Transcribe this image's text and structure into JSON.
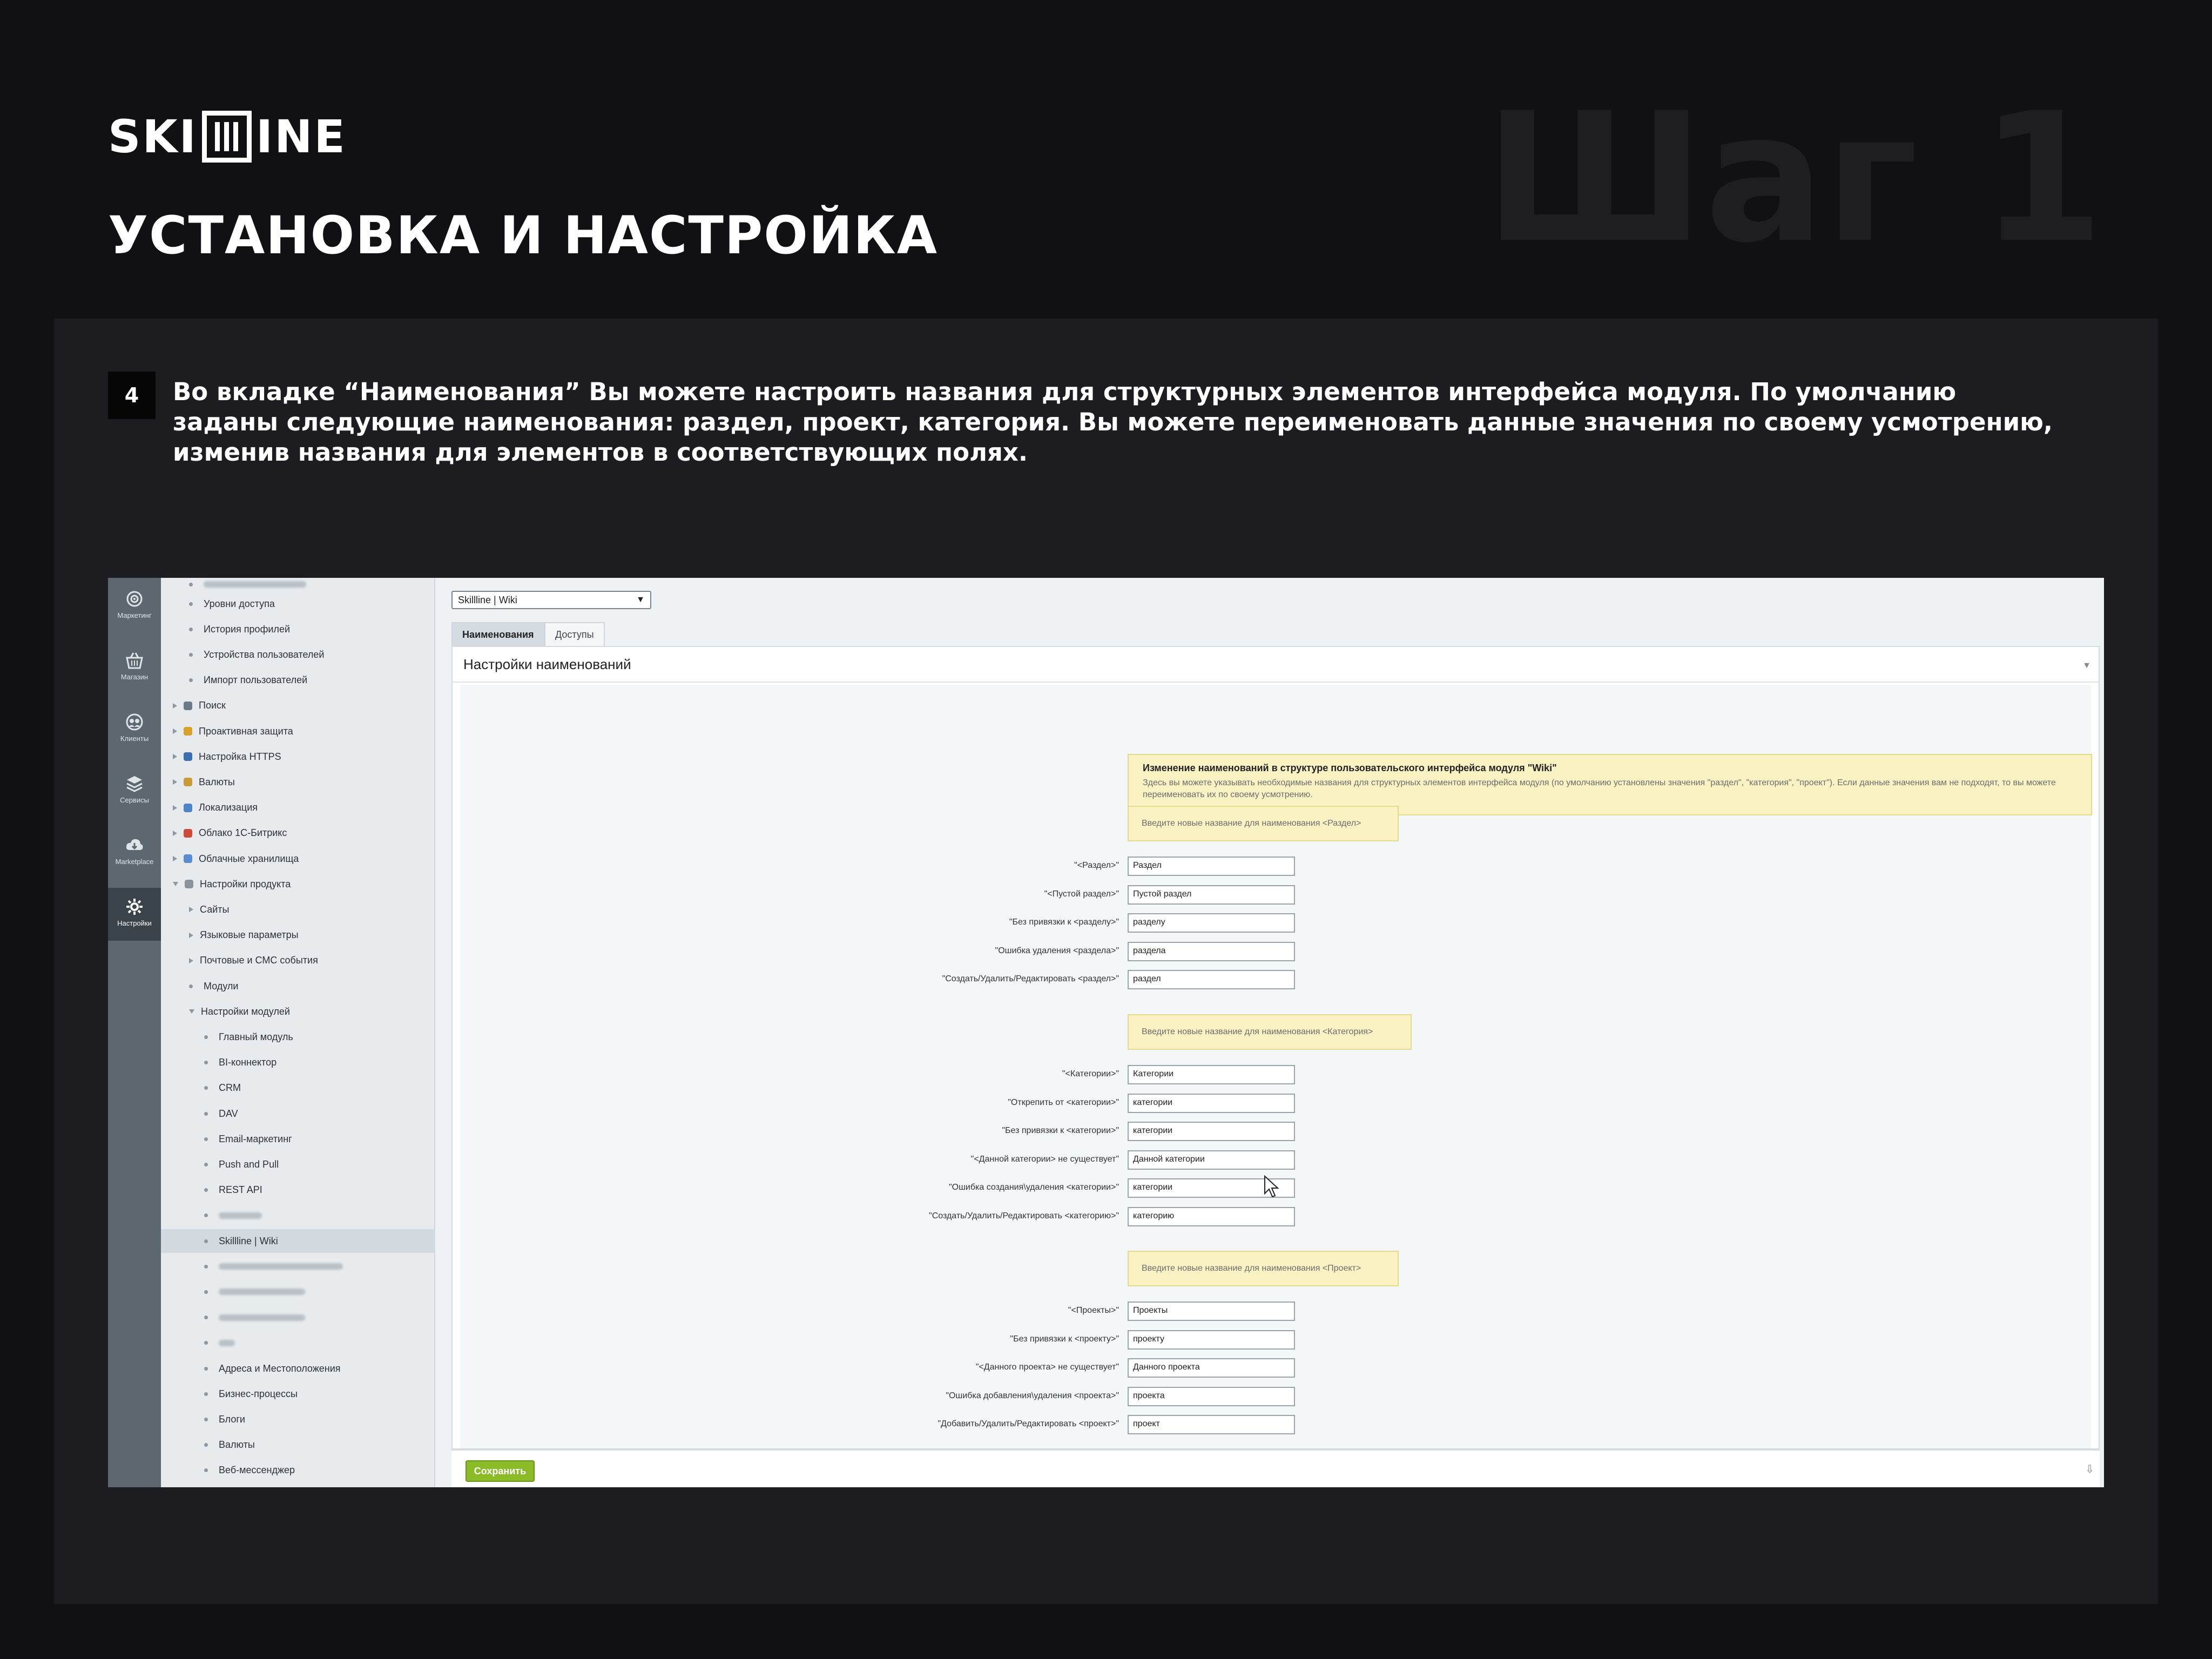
{
  "slide": {
    "logo_left": "SKI",
    "logo_right": "INE",
    "title": "УСТАНОВКА И НАСТРОЙКА",
    "step": "Шаг 1",
    "item_number": "4",
    "instruction": "Во вкладке “Наименования” Вы можете настроить названия для структурных элементов интерфейса модуля. По умолчанию заданы следующие наименования: раздел, проект, категория. Вы можете переименовать данные значения по своему усмотрению, изменив названия для элементов в соответствующих полях."
  },
  "rail": [
    {
      "label": "Маркетинг",
      "icon": "target-icon"
    },
    {
      "label": "Магазин",
      "icon": "basket-icon"
    },
    {
      "label": "Клиенты",
      "icon": "clients-icon"
    },
    {
      "label": "Сервисы",
      "icon": "layers-icon"
    },
    {
      "label": "Marketplace",
      "icon": "cloud-download-icon"
    },
    {
      "label": "Настройки",
      "icon": "gear-icon",
      "active": true
    }
  ],
  "tree": [
    {
      "label": "Уровни доступа",
      "level": 2,
      "kind": "bullet"
    },
    {
      "label": "История профилей",
      "level": 2,
      "kind": "bullet"
    },
    {
      "label": "Устройства пользователей",
      "level": 2,
      "kind": "bullet"
    },
    {
      "label": "Импорт пользователей",
      "level": 2,
      "kind": "bullet"
    },
    {
      "label": "Поиск",
      "level": 1,
      "kind": "arrow",
      "icon": "#6b7a86"
    },
    {
      "label": "Проактивная защита",
      "level": 1,
      "kind": "arrow",
      "icon": "#d7a12b"
    },
    {
      "label": "Настройка HTTPS",
      "level": 1,
      "kind": "arrow",
      "icon": "#3b6fb0"
    },
    {
      "label": "Валюты",
      "level": 1,
      "kind": "arrow",
      "icon": "#c89a3a"
    },
    {
      "label": "Локализация",
      "level": 1,
      "kind": "arrow",
      "icon": "#4d86c4"
    },
    {
      "label": "Облако 1С-Битрикс",
      "level": 1,
      "kind": "arrow",
      "icon": "#d04a3a"
    },
    {
      "label": "Облачные хранилища",
      "level": 1,
      "kind": "arrow",
      "icon": "#5a8ccf"
    },
    {
      "label": "Настройки продукта",
      "level": 1,
      "kind": "open",
      "icon": "#8a939b"
    },
    {
      "label": "Сайты",
      "level": 2,
      "kind": "arrow"
    },
    {
      "label": "Языковые параметры",
      "level": 2,
      "kind": "arrow"
    },
    {
      "label": "Почтовые и СМС события",
      "level": 2,
      "kind": "arrow"
    },
    {
      "label": "Модули",
      "level": 2,
      "kind": "bullet"
    },
    {
      "label": "Настройки модулей",
      "level": 2,
      "kind": "open"
    },
    {
      "label": "Главный модуль",
      "level": 3,
      "kind": "bullet"
    },
    {
      "label": "BI-коннектор",
      "level": 3,
      "kind": "bullet"
    },
    {
      "label": "CRM",
      "level": 3,
      "kind": "bullet"
    },
    {
      "label": "DAV",
      "level": 3,
      "kind": "bullet"
    },
    {
      "label": "Email-маркетинг",
      "level": 3,
      "kind": "bullet"
    },
    {
      "label": "Push and Pull",
      "level": 3,
      "kind": "bullet"
    },
    {
      "label": "REST API",
      "level": 3,
      "kind": "bullet"
    },
    {
      "label": "",
      "level": 3,
      "kind": "bullet",
      "blur": 80
    },
    {
      "label": "Skillline | Wiki",
      "level": 3,
      "kind": "bullet",
      "selected": true
    },
    {
      "label": "",
      "level": 3,
      "kind": "bullet",
      "blur": 230
    },
    {
      "label": "",
      "level": 3,
      "kind": "bullet",
      "blur": 160
    },
    {
      "label": "",
      "level": 3,
      "kind": "bullet",
      "blur": 160
    },
    {
      "label": "",
      "level": 3,
      "kind": "bullet",
      "blur": 30
    },
    {
      "label": "Адреса и Местоположения",
      "level": 3,
      "kind": "bullet"
    },
    {
      "label": "Бизнес-процессы",
      "level": 3,
      "kind": "bullet"
    },
    {
      "label": "Блоги",
      "level": 3,
      "kind": "bullet"
    },
    {
      "label": "Валюты",
      "level": 3,
      "kind": "bullet"
    },
    {
      "label": "Веб-мессенджер",
      "level": 3,
      "kind": "bullet"
    }
  ],
  "main": {
    "select_value": "Skillline | Wiki",
    "tab_active": "Наименования",
    "tab_inactive": "Доступы",
    "card_title": "Настройки наименований",
    "note_title": "Изменение наименований в структуре пользовательского интерфейса модуля \"Wiki\"",
    "note_text": "Здесь вы можете указывать необходимые названия для структурных элементов интерфейса модуля (по умолчанию установлены значения \"раздел\", \"категория\", \"проект\"). Если данные значения вам не подходят, то вы можете переименовать их по своему усмотрению.",
    "sections": [
      {
        "header": "Введите новые название для наименования <Раздел>",
        "rows": [
          {
            "label": "\"<Раздел>\"",
            "value": "Раздел"
          },
          {
            "label": "\"<Пустой раздел>\"",
            "value": "Пустой раздел"
          },
          {
            "label": "\"Без привязки к <разделу>\"",
            "value": "разделу"
          },
          {
            "label": "\"Ошибка удаления <раздела>\"",
            "value": "раздела"
          },
          {
            "label": "\"Создать/Удалить/Редактировать <раздел>\"",
            "value": "раздел"
          }
        ]
      },
      {
        "header": "Введите новые название для наименования <Категория>",
        "rows": [
          {
            "label": "\"<Категории>\"",
            "value": "Категории"
          },
          {
            "label": "\"Открепить от <категории>\"",
            "value": "категории"
          },
          {
            "label": "\"Без привязки к <категории>\"",
            "value": "категории"
          },
          {
            "label": "\"<Данной категории> не существует\"",
            "value": "Данной категории"
          },
          {
            "label": "\"Ошибка создания\\удаления <категории>\"",
            "value": "категории"
          },
          {
            "label": "\"Создать/Удалить/Редактировать <категорию>\"",
            "value": "категорию"
          }
        ]
      },
      {
        "header": "Введите новые название для наименования <Проект>",
        "rows": [
          {
            "label": "\"<Проекты>\"",
            "value": "Проекты"
          },
          {
            "label": "\"Без привязки к <проекту>\"",
            "value": "проекту"
          },
          {
            "label": "\"<Данного проекта> не существует\"",
            "value": "Данного проекта"
          },
          {
            "label": "\"Ошибка добавления\\удаления <проекта>\"",
            "value": "проекта"
          },
          {
            "label": "\"Добавить/Удалить/Редактировать <проект>\"",
            "value": "проект"
          }
        ]
      }
    ],
    "save_label": "Сохранить"
  }
}
